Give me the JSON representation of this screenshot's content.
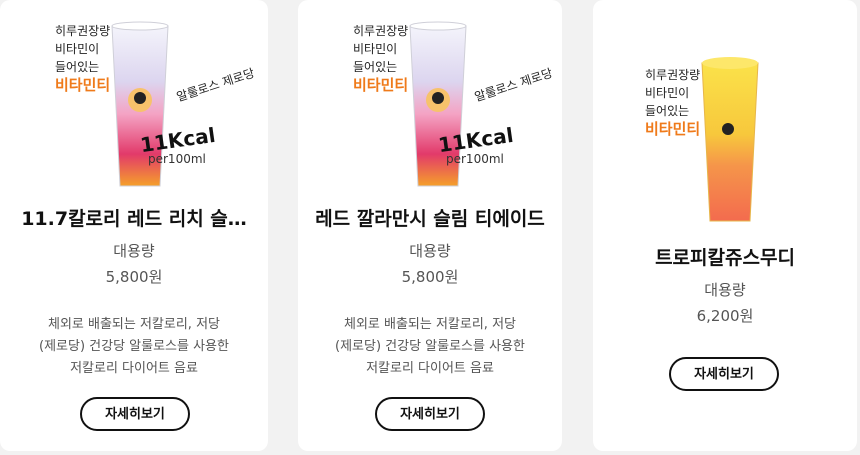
{
  "products": [
    {
      "promo_lines": [
        "히루권장량",
        "비타민이",
        "들어있는"
      ],
      "promo_brand": "비타민티",
      "tag_alulose": "알룰로스 제로당",
      "tag_kcal": "11Kcal",
      "tag_per": "per100ml",
      "name": "11.7칼로리 레드 리치 슬…",
      "size": "대용량",
      "price": "5,800원",
      "desc_lines": [
        "체외로 배출되는 저칼로리, 저당",
        "(제로당) 건강당 알룰로스를 사용한",
        "저칼로리 다이어트 음료"
      ],
      "button": "자세히보기"
    },
    {
      "promo_lines": [
        "히루권장량",
        "비타민이",
        "들어있는"
      ],
      "promo_brand": "비타민티",
      "tag_alulose": "알룰로스 제로당",
      "tag_kcal": "11Kcal",
      "tag_per": "per100ml",
      "name": "레드 깔라만시 슬림 티에이드",
      "size": "대용량",
      "price": "5,800원",
      "desc_lines": [
        "체외로 배출되는 저칼로리, 저당",
        "(제로당) 건강당 알룰로스를 사용한",
        "저칼로리 다이어트 음료"
      ],
      "button": "자세히보기"
    },
    {
      "promo_lines": [
        "히루권장량",
        "비타민이",
        "들어있는"
      ],
      "promo_brand": "비타민티",
      "name": "트로피칼쥬스무디",
      "size": "대용량",
      "price": "6,200원",
      "button": "자세히보기"
    }
  ]
}
